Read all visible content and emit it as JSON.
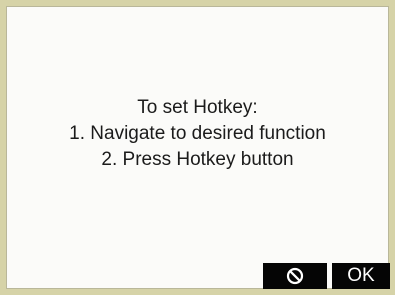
{
  "message": {
    "lines": [
      "To set Hotkey:",
      "1. Navigate to desired function",
      "2. Press Hotkey button"
    ]
  },
  "softkeys": {
    "cancel": {
      "icon": "cancel-icon"
    },
    "ok": {
      "label": "OK"
    }
  },
  "colors": {
    "bezel": "#d6d3a8",
    "screen": "#fbfbf9",
    "softkey_bg": "#050505",
    "softkey_fg": "#ffffff",
    "text": "#1b1b1b"
  }
}
